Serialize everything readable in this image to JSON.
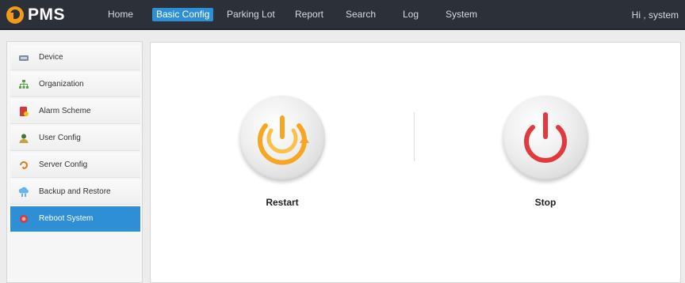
{
  "app": {
    "name": "PMS"
  },
  "nav": {
    "items": [
      {
        "label": "Home"
      },
      {
        "label": "Basic Config"
      },
      {
        "label": "Parking Lot"
      },
      {
        "label": "Report"
      },
      {
        "label": "Search"
      },
      {
        "label": "Log"
      },
      {
        "label": "System"
      }
    ],
    "active": "Basic Config",
    "greeting": "Hi , system"
  },
  "sidebar": {
    "items": [
      {
        "label": "Device",
        "icon": "device-icon"
      },
      {
        "label": "Organization",
        "icon": "organization-icon"
      },
      {
        "label": "Alarm Scheme",
        "icon": "alarm-scheme-icon"
      },
      {
        "label": "User Config",
        "icon": "user-icon"
      },
      {
        "label": "Server Config",
        "icon": "server-config-icon"
      },
      {
        "label": "Backup and Restore",
        "icon": "backup-icon"
      },
      {
        "label": "Reboot System",
        "icon": "reboot-icon"
      }
    ],
    "active": "Reboot System"
  },
  "main": {
    "restart_label": "Restart",
    "stop_label": "Stop"
  },
  "colors": {
    "topbar": "#2c3038",
    "accent": "#2d8fd5",
    "restart": "#f5a623",
    "stop": "#e0393e"
  }
}
